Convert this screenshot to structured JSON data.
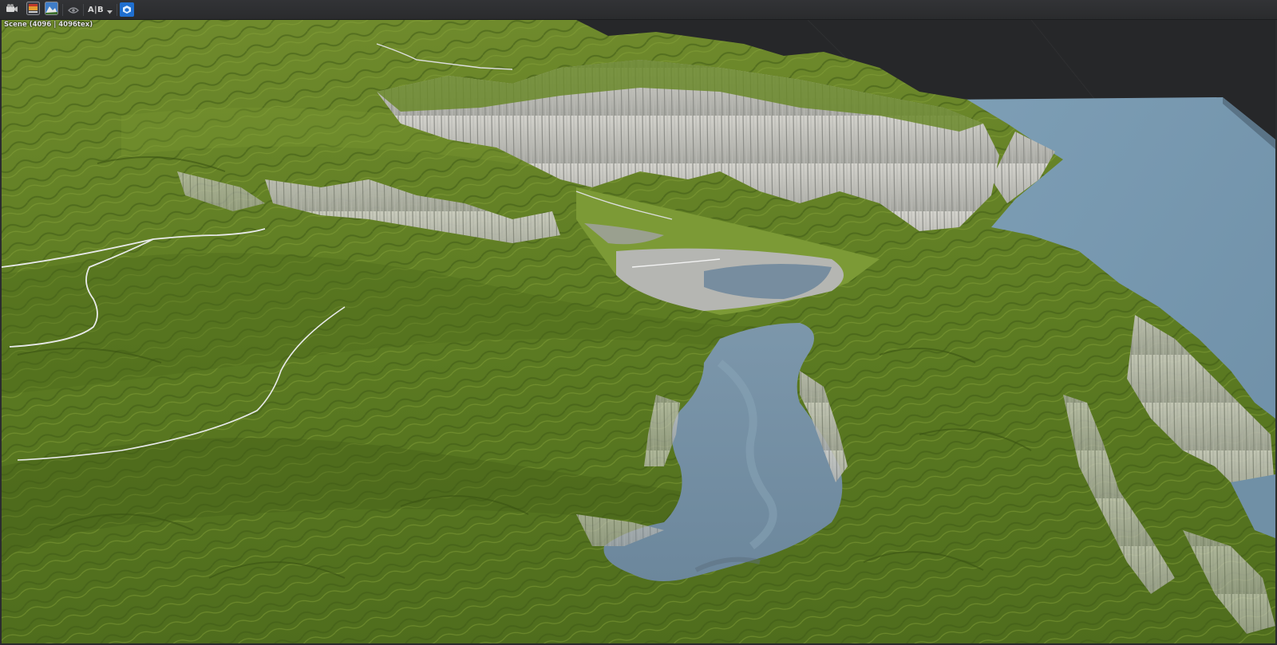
{
  "toolbar": {
    "buttons": [
      {
        "name": "camera-tools-icon",
        "kind": "icon"
      },
      {
        "name": "render-preview-icon",
        "kind": "icon"
      },
      {
        "name": "landscape-preview-icon",
        "kind": "icon"
      },
      {
        "name": "eye-icon",
        "kind": "icon"
      },
      {
        "name": "ab-compare",
        "label": "A|B"
      },
      {
        "name": "solid-view-icon",
        "kind": "icon",
        "active": true
      }
    ],
    "ab_label": "A|B",
    "accent_color": "#1f6fd0"
  },
  "viewport": {
    "scene_label": "Scene (4096 | 4096tex)",
    "background_color": "#262729",
    "terrain_color": "#5f7f24",
    "rock_color": "#c9c9c4",
    "water_color": "#7f9fb3"
  }
}
